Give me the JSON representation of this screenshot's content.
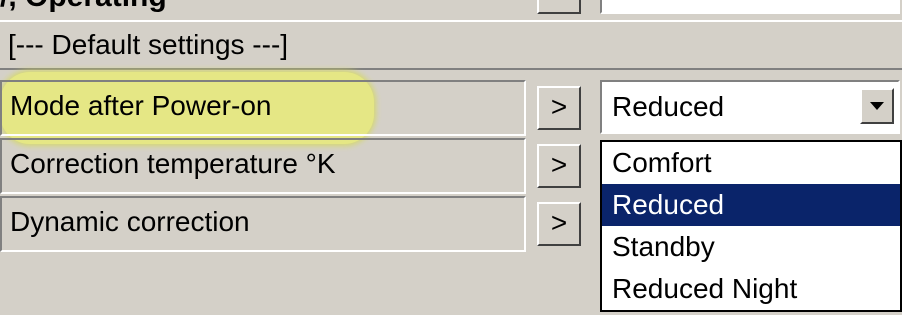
{
  "header": {
    "partial_title": "/, Operating",
    "section_label": "[--- Default settings ---]"
  },
  "rows": [
    {
      "label": "Mode after Power-on",
      "button_label": ">"
    },
    {
      "label": "Correction temperature °K",
      "button_label": ">"
    },
    {
      "label": "Dynamic correction",
      "button_label": ">"
    }
  ],
  "mode_select": {
    "value": "Reduced",
    "arrow_icon": "dropdown-arrow-icon",
    "options": [
      "Comfort",
      "Reduced",
      "Standby",
      "Reduced Night"
    ],
    "selected_index": 1
  },
  "colors": {
    "selection": "#0a246a",
    "highlight": "#e8ec7a",
    "panel": "#d4d0c8"
  }
}
